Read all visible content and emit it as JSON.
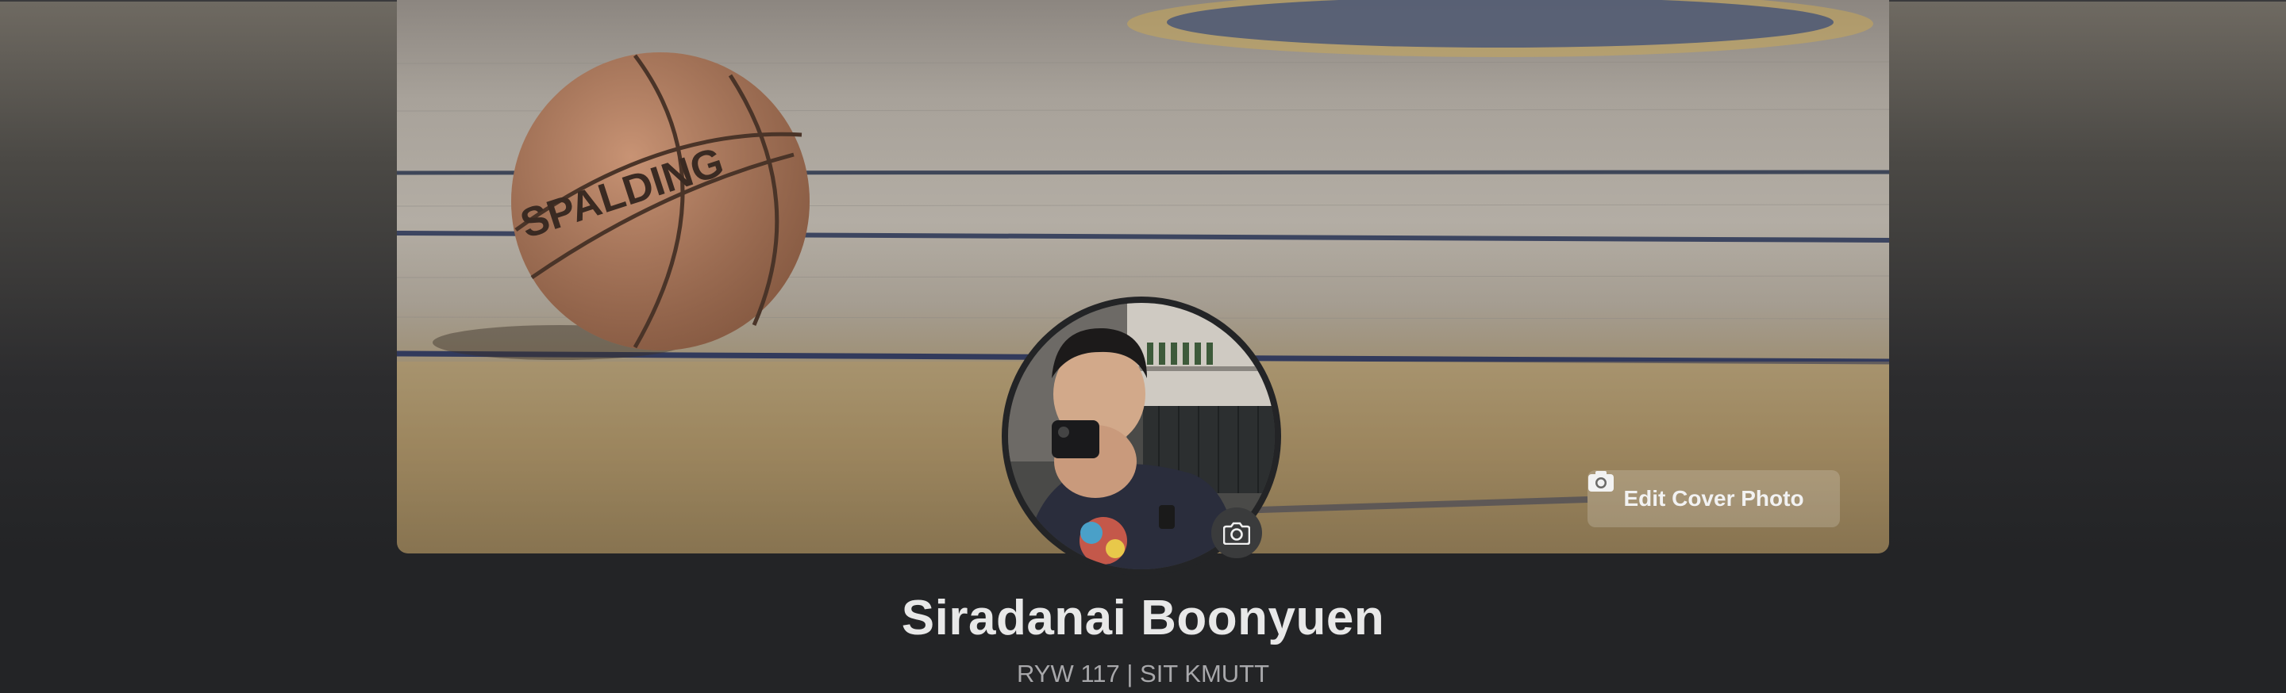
{
  "profile": {
    "name": "Siradanai Boonyuen",
    "bio": "RYW 117 | SIT KMUTT"
  },
  "cover": {
    "edit_label": "Edit Cover Photo",
    "ball_brand": "SPALDING"
  },
  "icons": {
    "edit_cover": "camera-icon",
    "avatar_edit": "camera-icon"
  },
  "colors": {
    "background": "#232426",
    "name_text": "#e8e8e8",
    "bio_text": "#a8a8ab",
    "button_bg": "rgba(255,255,255,0.18)"
  }
}
